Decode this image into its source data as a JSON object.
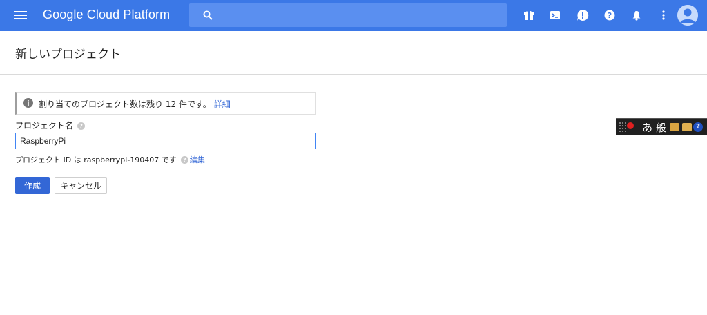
{
  "header": {
    "brand": "Google Cloud Platform",
    "search_placeholder": "",
    "icons": [
      "menu-icon",
      "search-icon",
      "gift-icon",
      "cloud-shell-icon",
      "notification-alert-icon",
      "help-icon",
      "bell-icon",
      "more-vert-icon",
      "account-avatar"
    ]
  },
  "page": {
    "title": "新しいプロジェクト"
  },
  "notice": {
    "text": "割り当てのプロジェクト数は残り 12 件です。",
    "link": "詳細"
  },
  "form": {
    "name_label": "プロジェクト名",
    "name_value": "RaspberryPi",
    "id_text": "プロジェクト ID は raspberrypi-190407 です",
    "id_edit_link": "編集",
    "create_label": "作成",
    "cancel_label": "キャンセル"
  },
  "ime": {
    "mode": "あ",
    "kanji": "般",
    "help": "?"
  },
  "colors": {
    "header_bg": "#3b78e7",
    "primary_button": "#3367d6",
    "link": "#3367d6"
  }
}
